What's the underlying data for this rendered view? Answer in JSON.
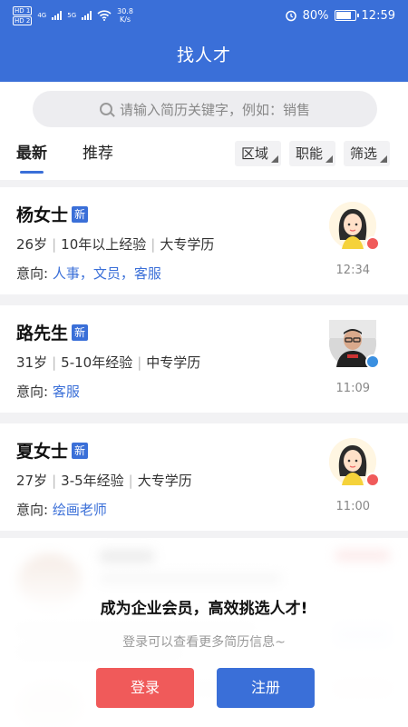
{
  "status_bar": {
    "speed_value": "30.8",
    "speed_unit": "K/s",
    "battery": "80%",
    "time": "12:59",
    "hd1": "HD 1",
    "hd2": "HD 2",
    "net1": "4G",
    "net2": "5G"
  },
  "header": {
    "title": "找人才"
  },
  "search": {
    "placeholder": "请输入简历关键字，例如：销售"
  },
  "tabs": [
    {
      "label": "最新"
    },
    {
      "label": "推荐"
    }
  ],
  "filters": [
    {
      "label": "区域"
    },
    {
      "label": "职能"
    },
    {
      "label": "筛选"
    }
  ],
  "candidates": [
    {
      "name": "杨女士",
      "badge": "新",
      "age": "26岁",
      "experience": "10年以上经验",
      "education": "大专学历",
      "intent_label": "意向:",
      "intent": "人事，文员，客服",
      "time": "12:34",
      "gender_color": "#f05a5a",
      "avatar_icon": "female-avatar-icon"
    },
    {
      "name": "路先生",
      "badge": "新",
      "age": "31岁",
      "experience": "5-10年经验",
      "education": "中专学历",
      "intent_label": "意向:",
      "intent": "客服",
      "time": "11:09",
      "gender_color": "#3a8fe0",
      "avatar_icon": "male-photo-avatar-icon"
    },
    {
      "name": "夏女士",
      "badge": "新",
      "age": "27岁",
      "experience": "3-5年经验",
      "education": "大专学历",
      "intent_label": "意向:",
      "intent": "绘画老师",
      "time": "11:00",
      "gender_color": "#f05a5a",
      "avatar_icon": "female-avatar-icon"
    }
  ],
  "promo": {
    "title": "成为企业会员，高效挑选人才!",
    "subtitle": "登录可以查看更多简历信息~"
  },
  "buttons": {
    "login": "登录",
    "register": "注册"
  },
  "colors": {
    "brand": "#3a6fd8",
    "login": "#f05a5a"
  }
}
